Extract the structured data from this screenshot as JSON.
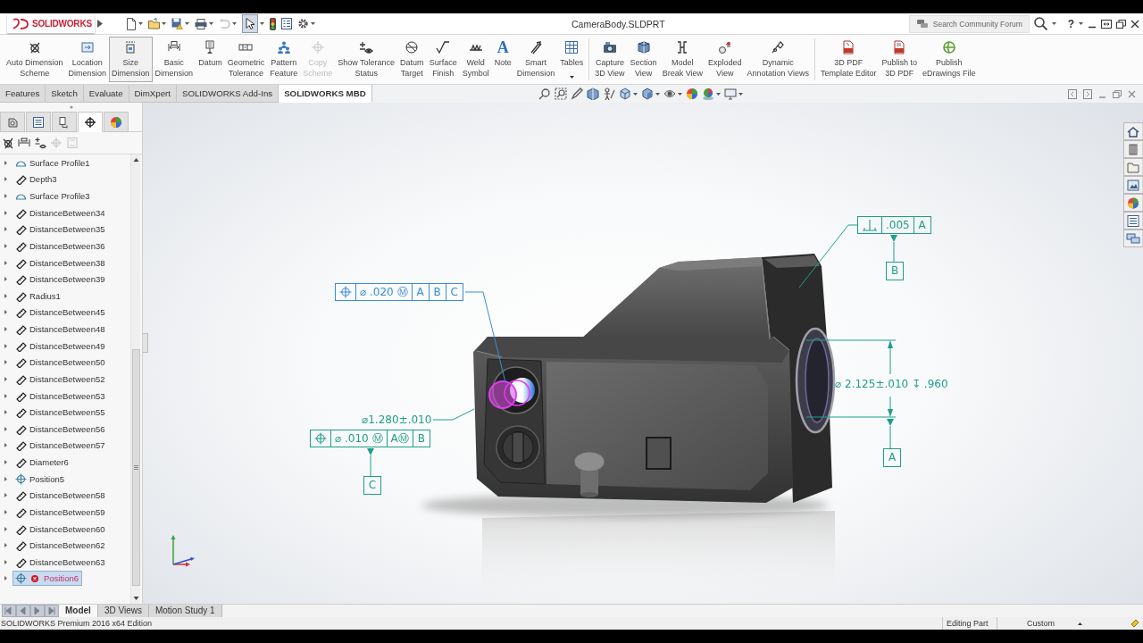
{
  "title_bar": {
    "logo": "SOLIDWORKS",
    "title": "CameraBody.SLDPRT",
    "search_placeholder": "Search Community Forum",
    "help": "?"
  },
  "quick_access": {
    "undo": {
      "disabled": true
    },
    "select": {
      "pressed": true
    }
  },
  "ribbon": {
    "groups": [
      [
        {
          "label": "Auto Dimension\nScheme",
          "kind": "autodim",
          "highlighted": false,
          "disabled": false,
          "menu": false
        },
        {
          "label": "Location\nDimension",
          "kind": "location",
          "highlighted": false,
          "disabled": false,
          "menu": false
        },
        {
          "label": "Size\nDimension",
          "kind": "size",
          "highlighted": true,
          "disabled": false,
          "menu": false
        },
        {
          "label": "Basic\nDimension",
          "kind": "basic",
          "highlighted": false,
          "disabled": false,
          "menu": false
        },
        {
          "label": "Datum",
          "kind": "datum",
          "highlighted": false,
          "disabled": false,
          "menu": false
        },
        {
          "label": "Geometric\nTolerance",
          "kind": "gtol",
          "highlighted": false,
          "disabled": false,
          "menu": false
        },
        {
          "label": "Pattern\nFeature",
          "kind": "pattern",
          "highlighted": false,
          "disabled": false,
          "menu": false
        },
        {
          "label": "Copy\nScheme",
          "kind": "copy",
          "highlighted": false,
          "disabled": true,
          "menu": false
        },
        {
          "label": "Show Tolerance\nStatus",
          "kind": "status",
          "highlighted": false,
          "disabled": false,
          "menu": false
        },
        {
          "label": "Datum\nTarget",
          "kind": "target",
          "highlighted": false,
          "disabled": false,
          "menu": false
        },
        {
          "label": "Surface\nFinish",
          "kind": "finish",
          "highlighted": false,
          "disabled": false,
          "menu": false
        },
        {
          "label": "Weld\nSymbol",
          "kind": "weld",
          "highlighted": false,
          "disabled": false,
          "menu": false
        },
        {
          "label": "Note",
          "kind": "note",
          "glyph": "A",
          "highlighted": false,
          "disabled": false,
          "menu": false
        },
        {
          "label": "Smart\nDimension",
          "kind": "smartdim",
          "highlighted": false,
          "disabled": false,
          "menu": false
        },
        {
          "label": "Tables",
          "kind": "table",
          "highlighted": false,
          "disabled": false,
          "menu": true
        }
      ],
      [
        {
          "label": "Capture\n3D View",
          "kind": "capture",
          "highlighted": false,
          "disabled": false,
          "menu": false
        },
        {
          "label": "Section\nView",
          "kind": "section",
          "highlighted": false,
          "disabled": false,
          "menu": false
        },
        {
          "label": "Model\nBreak View",
          "kind": "break",
          "highlighted": false,
          "disabled": false,
          "menu": false
        },
        {
          "label": "Exploded\nView",
          "kind": "explode",
          "highlighted": false,
          "disabled": false,
          "menu": false
        },
        {
          "label": "Dynamic\nAnnotation Views",
          "kind": "dynamic",
          "highlighted": false,
          "disabled": false,
          "menu": false
        }
      ],
      [
        {
          "label": "3D PDF\nTemplate Editor",
          "kind": "template",
          "highlighted": false,
          "disabled": false,
          "menu": false
        },
        {
          "label": "Publish to\n3D PDF",
          "kind": "pdf",
          "highlighted": false,
          "disabled": false,
          "menu": false
        },
        {
          "label": "Publish\neDrawings File",
          "kind": "edrawings",
          "highlighted": false,
          "disabled": false,
          "menu": false
        }
      ]
    ]
  },
  "command_tabs": [
    {
      "label": "Features",
      "selected": false
    },
    {
      "label": "Sketch",
      "selected": false
    },
    {
      "label": "Evaluate",
      "selected": false
    },
    {
      "label": "DimXpert",
      "selected": false
    },
    {
      "label": "SOLIDWORKS Add-Ins",
      "selected": false
    },
    {
      "label": "SOLIDWORKS MBD",
      "selected": true
    }
  ],
  "feature_manager": {
    "tabs": [
      {
        "kind": "feature",
        "selected": false
      },
      {
        "kind": "property",
        "selected": false
      },
      {
        "kind": "configuration",
        "selected": false
      },
      {
        "kind": "dimxpert",
        "selected": true
      },
      {
        "kind": "display",
        "selected": false
      }
    ],
    "tools": [
      {
        "kind": "autodim",
        "disabled": false
      },
      {
        "kind": "basic",
        "disabled": false
      },
      {
        "kind": "status",
        "disabled": false
      },
      {
        "kind": "position",
        "disabled": true
      },
      {
        "kind": "frame",
        "disabled": true
      }
    ],
    "tree": [
      {
        "label": "Surface Profile1",
        "kind": "profile",
        "expanded": false,
        "selected": false,
        "error": false
      },
      {
        "label": "Depth3",
        "kind": "dimension",
        "expanded": false,
        "selected": false,
        "error": false
      },
      {
        "label": "Surface Profile3",
        "kind": "profile",
        "expanded": false,
        "selected": false,
        "error": false
      },
      {
        "label": "DistanceBetween34",
        "kind": "dimension",
        "expanded": false,
        "selected": false,
        "error": false
      },
      {
        "label": "DistanceBetween35",
        "kind": "dimension",
        "expanded": false,
        "selected": false,
        "error": false
      },
      {
        "label": "DistanceBetween36",
        "kind": "dimension",
        "expanded": false,
        "selected": false,
        "error": false
      },
      {
        "label": "DistanceBetween38",
        "kind": "dimension",
        "expanded": false,
        "selected": false,
        "error": false
      },
      {
        "label": "DistanceBetween39",
        "kind": "dimension",
        "expanded": false,
        "selected": false,
        "error": false
      },
      {
        "label": "Radius1",
        "kind": "dimension",
        "expanded": false,
        "selected": false,
        "error": false
      },
      {
        "label": "DistanceBetween45",
        "kind": "dimension",
        "expanded": false,
        "selected": false,
        "error": false
      },
      {
        "label": "DistanceBetween48",
        "kind": "dimension",
        "expanded": false,
        "selected": false,
        "error": false
      },
      {
        "label": "DistanceBetween49",
        "kind": "dimension",
        "expanded": false,
        "selected": false,
        "error": false
      },
      {
        "label": "DistanceBetween50",
        "kind": "dimension",
        "expanded": false,
        "selected": false,
        "error": false
      },
      {
        "label": "DistanceBetween52",
        "kind": "dimension",
        "expanded": false,
        "selected": false,
        "error": false
      },
      {
        "label": "DistanceBetween53",
        "kind": "dimension",
        "expanded": false,
        "selected": false,
        "error": false
      },
      {
        "label": "DistanceBetween55",
        "kind": "dimension",
        "expanded": false,
        "selected": false,
        "error": false
      },
      {
        "label": "DistanceBetween56",
        "kind": "dimension",
        "expanded": false,
        "selected": false,
        "error": false
      },
      {
        "label": "DistanceBetween57",
        "kind": "dimension",
        "expanded": false,
        "selected": false,
        "error": false
      },
      {
        "label": "Diameter6",
        "kind": "dimension",
        "expanded": false,
        "selected": false,
        "error": false
      },
      {
        "label": "Position5",
        "kind": "position",
        "expanded": false,
        "selected": false,
        "error": false
      },
      {
        "label": "DistanceBetween58",
        "kind": "dimension",
        "expanded": false,
        "selected": false,
        "error": false
      },
      {
        "label": "DistanceBetween59",
        "kind": "dimension",
        "expanded": false,
        "selected": false,
        "error": false
      },
      {
        "label": "DistanceBetween60",
        "kind": "dimension",
        "expanded": false,
        "selected": false,
        "error": false
      },
      {
        "label": "DistanceBetween62",
        "kind": "dimension",
        "expanded": false,
        "selected": false,
        "error": false
      },
      {
        "label": "DistanceBetween63",
        "kind": "dimension",
        "expanded": false,
        "selected": false,
        "error": false
      },
      {
        "label": "Position6",
        "kind": "position",
        "expanded": false,
        "selected": true,
        "error": true
      }
    ]
  },
  "annotations": [
    {
      "kind": "position",
      "selected": true,
      "cells": [
        "⌀ .020 Ⓜ",
        "A",
        "B",
        "C"
      ]
    },
    {
      "kind": "dimension",
      "text": "⌀1.280±.010",
      "selected": false
    },
    {
      "kind": "position",
      "selected": false,
      "cells": [
        "⌀ .010 Ⓜ",
        "AⓂ",
        "B"
      ],
      "datum": "C"
    },
    {
      "kind": "perpendicularity",
      "selected": false,
      "cells": [
        ".005",
        "A"
      ],
      "datum": "B"
    },
    {
      "kind": "dimension",
      "text": "⌀ 2.125±.010 ↧ .960",
      "selected": false,
      "datum": "A"
    }
  ],
  "bottom_tabs": [
    {
      "label": "Model",
      "selected": true
    },
    {
      "label": "3D Views",
      "selected": false
    },
    {
      "label": "Motion Study 1",
      "selected": false
    }
  ],
  "status_bar": {
    "edition": "SOLIDWORKS Premium 2016 x64 Edition",
    "mode": "Editing Part",
    "units": "Custom"
  }
}
